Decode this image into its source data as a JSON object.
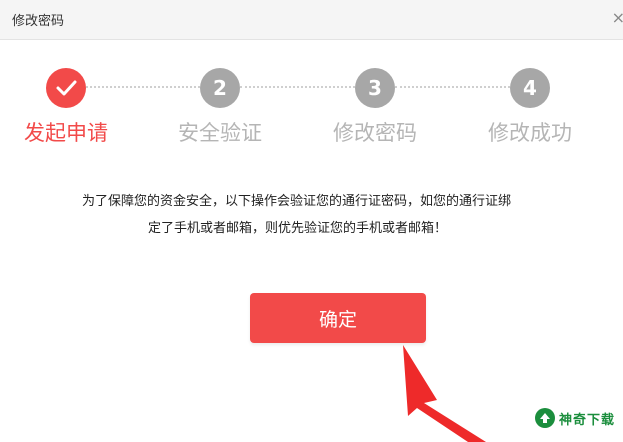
{
  "window": {
    "title": "修改密码",
    "close_glyph": "×"
  },
  "steps": [
    {
      "number": "",
      "label": "发起申请",
      "state": "done",
      "icon": "check-icon"
    },
    {
      "number": "2",
      "label": "安全验证",
      "state": "pending"
    },
    {
      "number": "3",
      "label": "修改密码",
      "state": "pending"
    },
    {
      "number": "4",
      "label": "修改成功",
      "state": "pending"
    }
  ],
  "message": {
    "line1": "为了保障您的资金安全，以下操作会验证您的通行证密码，如您的通行证绑",
    "line2": "定了手机或者邮箱，则优先验证您的手机或者邮箱！"
  },
  "confirm_button": {
    "label": "确定"
  },
  "watermark": {
    "text": "神奇下载"
  },
  "colors": {
    "accent": "#f24a49",
    "step_inactive": "#a7a7a7",
    "label_inactive": "#b5b5b5",
    "watermark_green": "#1b8e3d"
  },
  "annotation": {
    "arrow_color": "#ee2a2a",
    "icon": "pointer-arrow-icon"
  }
}
